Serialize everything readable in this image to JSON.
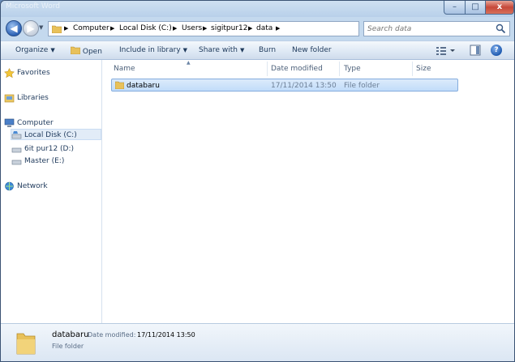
{
  "window": {
    "ghost_title": "Microsoft Word",
    "minimize": "–",
    "maximize": "□",
    "close": "x"
  },
  "address": {
    "breadcrumb": [
      "Computer",
      "Local Disk (C:)",
      "Users",
      "sigitpur12",
      "data"
    ],
    "back_glyph": "◀",
    "forward_glyph": "▶"
  },
  "search": {
    "placeholder": "Search data"
  },
  "toolbar": {
    "organize": "Organize",
    "open": "Open",
    "include": "Include in library",
    "share": "Share with",
    "burn": "Burn",
    "new_folder": "New folder"
  },
  "nav": {
    "favorites": "Favorites",
    "libraries": "Libraries",
    "computer": "Computer",
    "local_disk": "Local Disk (C:)",
    "drive_d": "6it pur12 (D:)",
    "drive_e": "Master (E:)",
    "network": "Network"
  },
  "columns": {
    "name": "Name",
    "date": "Date modified",
    "type": "Type",
    "size": "Size"
  },
  "files": [
    {
      "name": "databaru",
      "date": "17/11/2014 13:50",
      "type": "File folder",
      "size": ""
    }
  ],
  "details": {
    "name": "databaru",
    "date_label": "Date modified:",
    "date": "17/11/2014 13:50",
    "type": "File folder"
  },
  "colors": {
    "accent": "#1e395b",
    "selection": "#c1dcfa",
    "folder": "#e8c15a"
  },
  "icons": {
    "favorites": "star-icon",
    "libraries": "library-icon",
    "computer": "computer-icon",
    "drive": "drive-icon",
    "network": "network-icon",
    "folder": "folder-icon"
  }
}
